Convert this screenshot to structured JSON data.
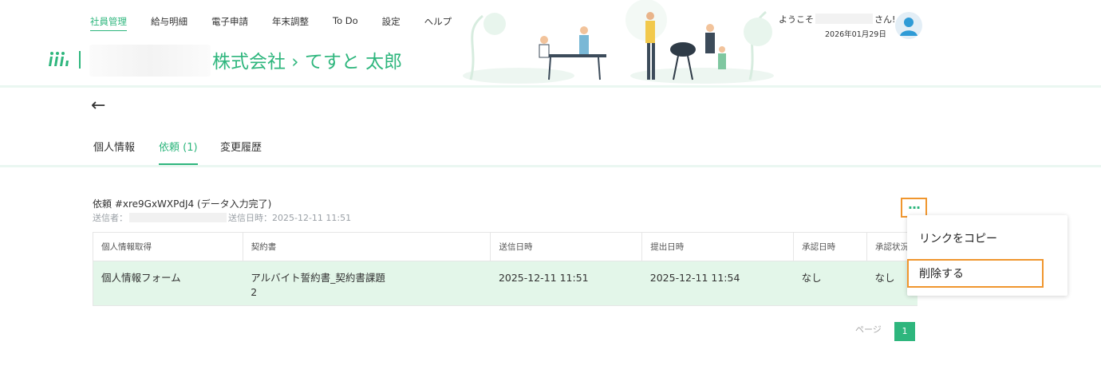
{
  "header": {
    "nav": [
      "社員管理",
      "給与明細",
      "電子申請",
      "年末調整",
      "To Do",
      "設定",
      "ヘルプ"
    ],
    "company_title": "株式会社 › てすと 太郎",
    "welcome_prefix": "ようこそ",
    "welcome_suffix": "さん!",
    "date": "2026年01月29日"
  },
  "tabs": [
    "個人情報",
    "依頼 (1)",
    "変更履歴"
  ],
  "request": {
    "title": "依頼 #xre9GxWXPdJ4 (データ入力完了)",
    "sender_label": "送信者：",
    "sent_datetime": "送信日時：2025-12-11 11:51"
  },
  "table": {
    "headers": [
      "個人情報取得",
      "契約書",
      "送信日時",
      "提出日時",
      "承認日時",
      "承認状況"
    ],
    "rows": [
      [
        "個人情報フォーム",
        "アルバイト誓約書_契約書課題\n2",
        "2025-12-11 11:51",
        "2025-12-11 11:54",
        "なし",
        "なし"
      ]
    ]
  },
  "menu": {
    "copy_link": "リンクをコピー",
    "delete": "削除する"
  },
  "more_label": "...",
  "pager": {
    "label": "ページ",
    "current": "1"
  },
  "colors": {
    "accent": "#2eb67d",
    "highlight": "#f0962e",
    "row_bg": "#e3f6e9"
  }
}
